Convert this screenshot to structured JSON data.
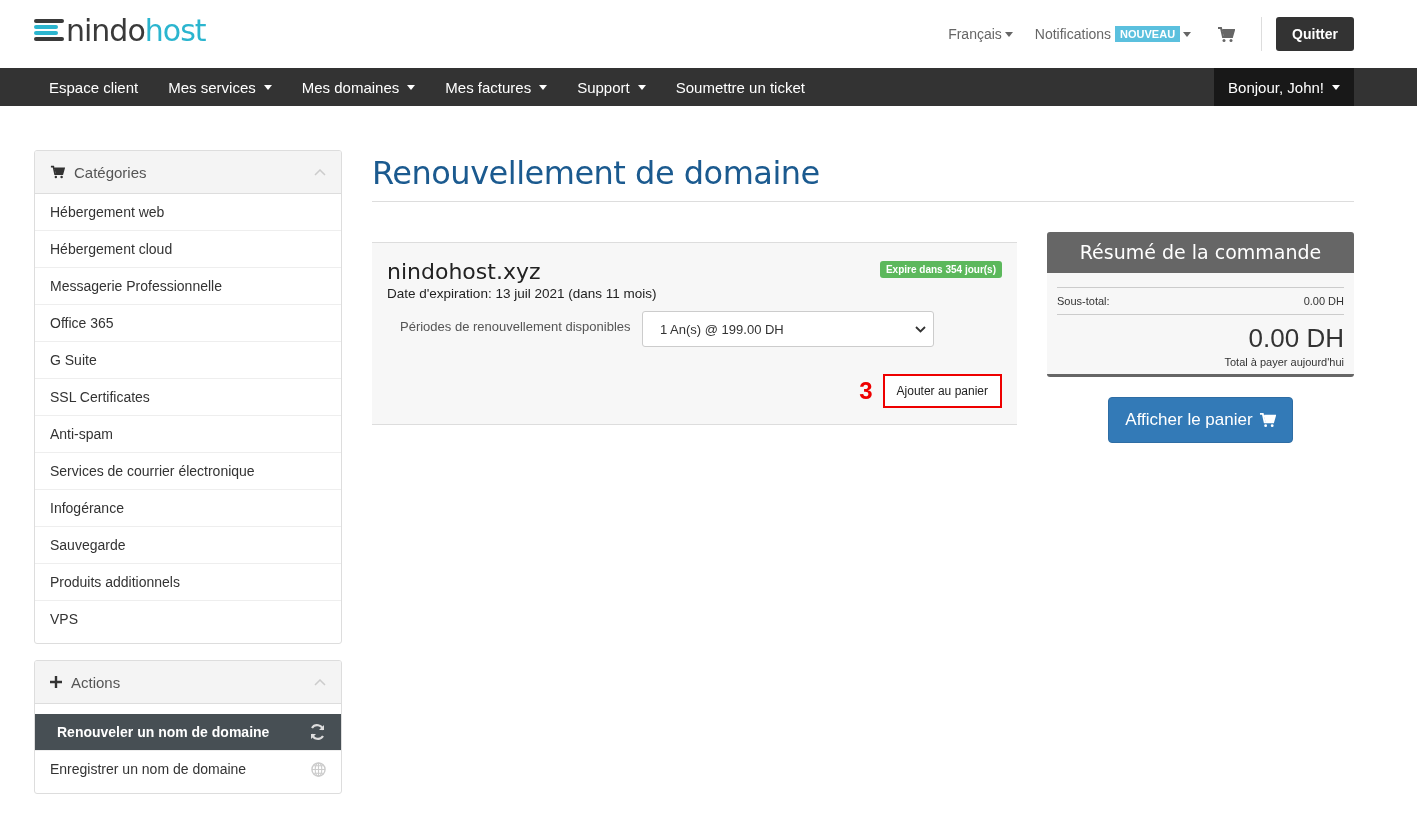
{
  "header": {
    "logo": {
      "dark": "nindo",
      "light": "host"
    },
    "language": "Français",
    "notifications": {
      "label": "Notifications",
      "badge": "NOUVEAU"
    },
    "logout": "Quitter"
  },
  "nav": {
    "items": [
      {
        "label": "Espace client",
        "caret": false
      },
      {
        "label": "Mes services",
        "caret": true
      },
      {
        "label": "Mes domaines",
        "caret": true
      },
      {
        "label": "Mes factures",
        "caret": true
      },
      {
        "label": "Support",
        "caret": true
      },
      {
        "label": "Soumettre un ticket",
        "caret": false
      }
    ],
    "user": "Bonjour, John!"
  },
  "sidebar": {
    "panels": [
      {
        "title": "Catégories",
        "kind": "cart",
        "items": [
          {
            "label": "Hébergement web",
            "selected": false
          },
          {
            "label": "Hébergement cloud",
            "selected": false
          },
          {
            "label": "Messagerie Professionnelle",
            "selected": false
          },
          {
            "label": "Office 365",
            "selected": false
          },
          {
            "label": "G Suite",
            "selected": false
          },
          {
            "label": "SSL Certificates",
            "selected": false
          },
          {
            "label": "Anti-spam",
            "selected": false
          },
          {
            "label": "Services de courrier électronique",
            "selected": false
          },
          {
            "label": "Infogérance",
            "selected": false
          },
          {
            "label": "Sauvegarde",
            "selected": false
          },
          {
            "label": "Produits additionnels",
            "selected": false
          },
          {
            "label": "VPS",
            "selected": false
          }
        ]
      },
      {
        "title": "Actions",
        "kind": "plus",
        "items": [
          {
            "label": "Renouveler un nom de domaine",
            "selected": true,
            "kind": "refresh"
          },
          {
            "label": "Enregistrer un nom de domaine",
            "selected": false,
            "kind": "globe"
          }
        ]
      }
    ]
  },
  "page_title": "Renouvellement de domaine",
  "domain": {
    "name": "nindohost.xyz",
    "expiry": "Date d'expiration: 13 juil 2021 (dans 11 mois)",
    "badge": "Expire dans 354 jour(s)",
    "period_label": "Périodes de renouvellement disponibles",
    "period_value": "1 An(s) @ 199.00 DH",
    "step_marker": "3",
    "button": {
      "label": "Ajouter au panier",
      "highlighted": true
    }
  },
  "summary": {
    "title": "Résumé de la commande",
    "subtotal_label": "Sous-total:",
    "subtotal_value": "0.00 DH",
    "total": "0.00 DH",
    "total_label": "Total à payer aujourd'hui",
    "cart_button": "Afficher le panier"
  }
}
